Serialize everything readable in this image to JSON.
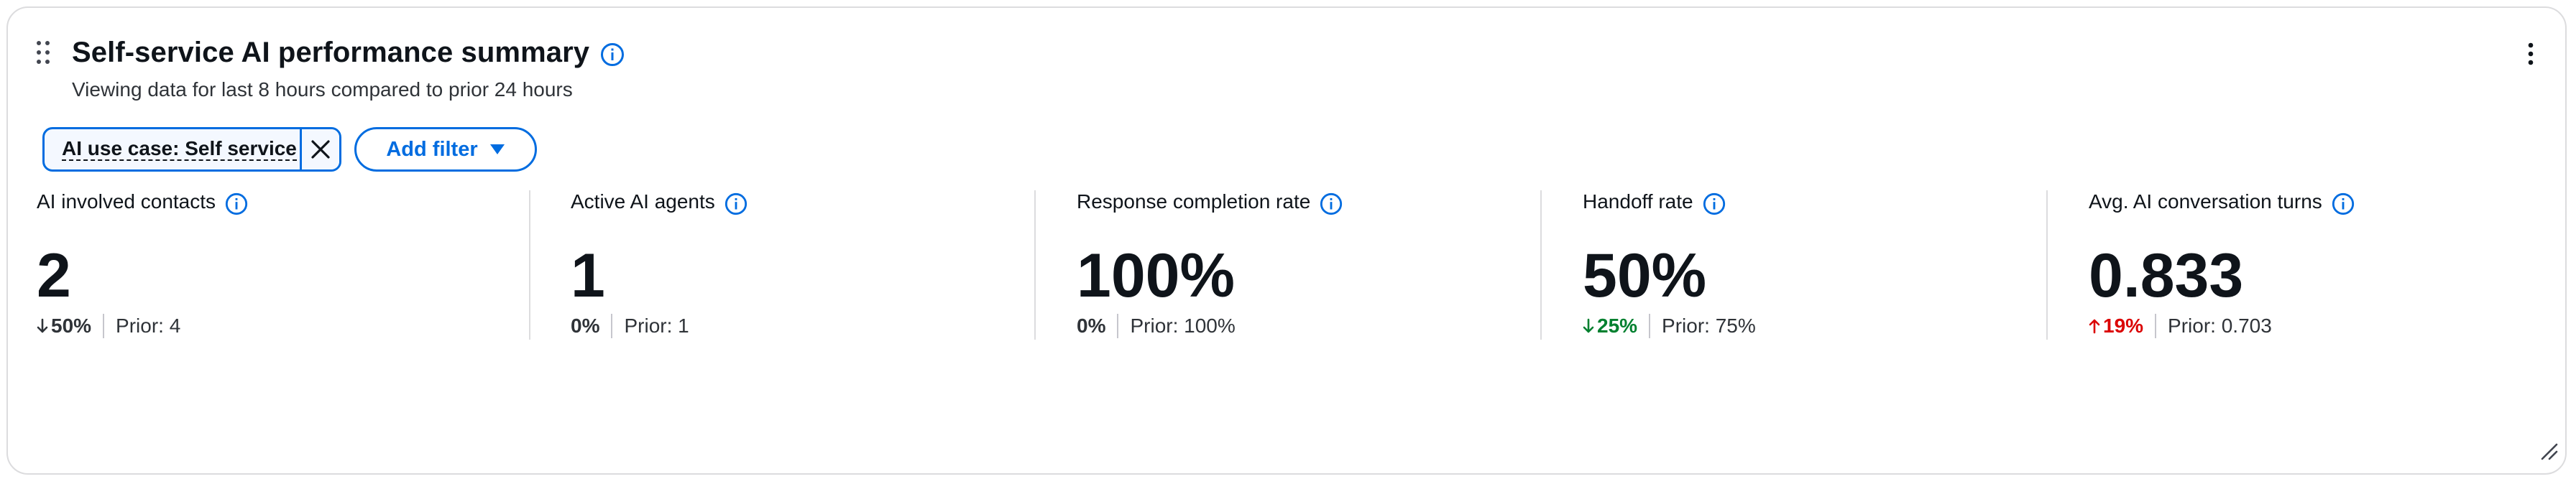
{
  "widget": {
    "title": "Self-service AI performance summary",
    "subtitle": "Viewing data for last 8 hours compared to prior 24 hours"
  },
  "filters": {
    "chip_label": "AI use case: Self service",
    "add_filter_label": "Add filter"
  },
  "metrics": [
    {
      "label": "AI involved contacts",
      "value": "2",
      "delta": "50%",
      "direction": "down",
      "tone": "neutral",
      "prior": "Prior: 4"
    },
    {
      "label": "Active AI agents",
      "value": "1",
      "delta": "0%",
      "direction": "none",
      "tone": "neutral",
      "prior": "Prior: 1"
    },
    {
      "label": "Response completion rate",
      "value": "100%",
      "delta": "0%",
      "direction": "none",
      "tone": "neutral",
      "prior": "Prior: 100%"
    },
    {
      "label": "Handoff rate",
      "value": "50%",
      "delta": "25%",
      "direction": "down",
      "tone": "good",
      "prior": "Prior: 75%"
    },
    {
      "label": "Avg. AI conversation turns",
      "value": "0.833",
      "delta": "19%",
      "direction": "up",
      "tone": "bad",
      "prior": "Prior: 0.703"
    }
  ],
  "colors": {
    "accent": "#006ce0",
    "positive": "#00802f",
    "negative": "#db0000",
    "border": "#dcdcde"
  },
  "icons": [
    "drag-handle-icon",
    "info-icon",
    "more-options-icon",
    "close-icon",
    "caret-down-icon",
    "arrow-down-icon",
    "arrow-up-icon",
    "resize-handle-icon"
  ]
}
